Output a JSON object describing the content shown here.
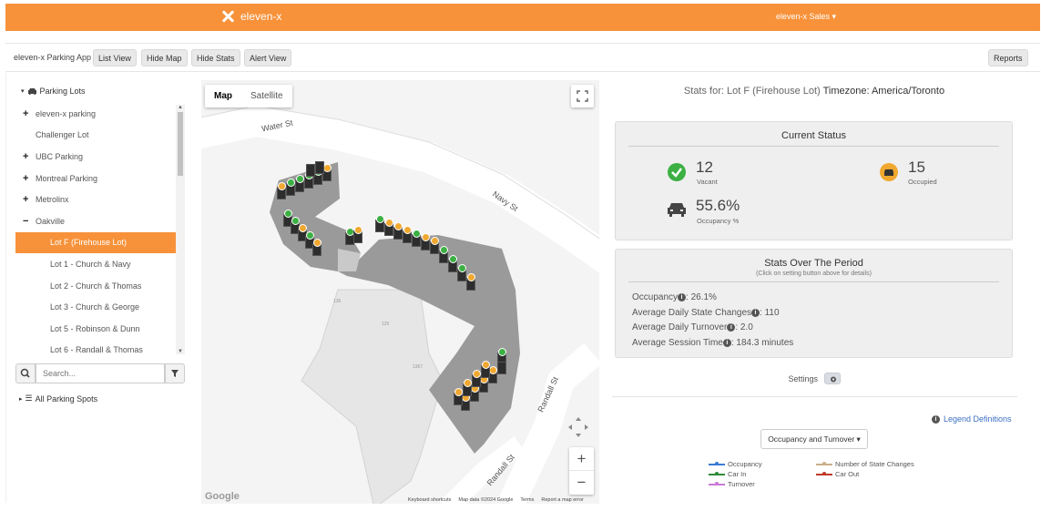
{
  "topbar": {
    "brand": "eleven-x",
    "user_menu": "eleven-x Sales ▾",
    "color": "#f7923a"
  },
  "toolbar": {
    "app_name": "eleven-x Parking App",
    "list_view": "List View",
    "hide_map": "Hide Map",
    "hide_stats": "Hide Stats",
    "alert_view": "Alert View",
    "reports": "Reports"
  },
  "sidebar": {
    "root_label": "Parking Lots",
    "items": [
      {
        "label": "eleven-x parking",
        "sign": "+",
        "level": 1
      },
      {
        "label": "Challenger Lot",
        "sign": "",
        "level": 1
      },
      {
        "label": "UBC Parking",
        "sign": "+",
        "level": 1
      },
      {
        "label": "Montreal Parking",
        "sign": "+",
        "level": 1
      },
      {
        "label": "Metrolinx",
        "sign": "+",
        "level": 1
      },
      {
        "label": "Oakville",
        "sign": "−",
        "level": 1
      },
      {
        "label": "Lot F (Firehouse Lot)",
        "sign": "",
        "level": 2,
        "selected": true
      },
      {
        "label": "Lot 1 - Church & Navy",
        "sign": "",
        "level": 2
      },
      {
        "label": "Lot 2 - Church & Thomas",
        "sign": "",
        "level": 2
      },
      {
        "label": "Lot 3 - Church & George",
        "sign": "",
        "level": 2
      },
      {
        "label": "Lot 5 - Robinson & Dunn",
        "sign": "",
        "level": 2
      },
      {
        "label": "Lot 6 - Randall & Thomas",
        "sign": "",
        "level": 2
      }
    ],
    "search_placeholder": "Search...",
    "all_spots": "All Parking Spots"
  },
  "map": {
    "tab_map": "Map",
    "tab_satellite": "Satellite",
    "streets": {
      "water": "Water St",
      "navy": "Navy St",
      "randall1": "Randall St",
      "randall2": "Randall St"
    },
    "building_labels": {
      "a": "136",
      "b": "125",
      "c": "1367"
    },
    "footer": {
      "shortcuts": "Keyboard shortcuts",
      "mapdata": "Map data ©2024 Google",
      "terms": "Terms",
      "report": "Report a map error"
    },
    "google": "Google",
    "zoom_in": "+",
    "zoom_out": "−"
  },
  "stats": {
    "header_prefix": "Stats for: Lot F (Firehouse Lot)",
    "timezone": "Timezone: America/Toronto",
    "current_status_title": "Current Status",
    "vacant_value": "12",
    "vacant_label": "Vacant",
    "occupied_value": "15",
    "occupied_label": "Occupied",
    "occupancy_value": "55.6%",
    "occupancy_label": "Occupancy %",
    "period_title": "Stats Over The Period",
    "period_subtitle": "(Click on setting button above for details)",
    "lines": [
      {
        "label": "Occupancy",
        "value": ": 26.1%"
      },
      {
        "label": "Average Daily State Changes",
        "value": ": 110"
      },
      {
        "label": "Average Daily Turnover",
        "value": ": 2.0"
      },
      {
        "label": "Average Session Time",
        "value": ": 184.3 minutes"
      }
    ],
    "settings_label": "Settings",
    "legend_definitions": "Legend Definitions",
    "chart_select": "Occupancy and Turnover ▾",
    "legend": [
      {
        "name": "Occupancy",
        "color": "#3a7bd5"
      },
      {
        "name": "Number of State Changes",
        "color": "#c8b08a"
      },
      {
        "name": "Car In",
        "color": "#2e8b3a"
      },
      {
        "name": "Car Out",
        "color": "#c0392b"
      },
      {
        "name": "Turnover",
        "color": "#c87ad6"
      }
    ],
    "vacant_color": "#3cb043",
    "occupied_color": "#f0a830"
  }
}
